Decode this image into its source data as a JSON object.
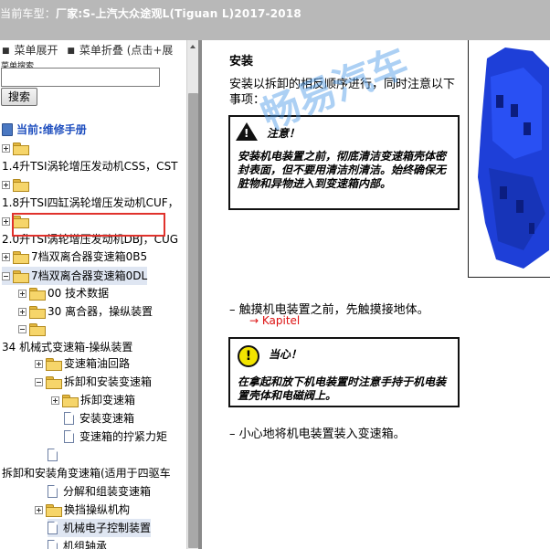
{
  "header": {
    "model_label": "当前车型：",
    "model_value": "厂家:S-上汽大众途观L(Tiguan L)2017-2018"
  },
  "sidebar": {
    "menu_expand": "菜单展开",
    "menu_collapse": "菜单折叠 (点击+展",
    "search_label": "菜单搜索",
    "search_value": "",
    "search_button": "搜索",
    "current_label": "当前:维修手册",
    "tree": {
      "item_1": "1.4升TSI涡轮增压发动机CSS，CST",
      "item_2": "1.8升TSI四缸涡轮增压发动机CUF，",
      "item_3": "2.0升TSI涡轮增压发动机DBJ，CUG",
      "item_4": "7档双离合器变速箱0B5",
      "item_5": "7档双离合器变速箱0DL",
      "item_6": "00 技术数据",
      "item_7": "30 离合器，操纵装置",
      "item_8": "34 机械式变速箱-操纵装置",
      "item_9": "变速箱油回路",
      "item_10": "拆卸和安装变速箱",
      "item_11": "拆卸变速箱",
      "item_12": "安装变速箱",
      "item_13": "变速箱的拧紧力矩",
      "item_14": "拆卸和安装角变速箱(适用于四驱车",
      "item_15": "分解和组装变速箱",
      "item_16": "换挡操纵机构",
      "item_17": "机械电子控制装置",
      "item_18": "机组轴承"
    }
  },
  "content": {
    "title": "安装",
    "intro": "安装以拆卸的相反顺序进行，同时注意以下事项：",
    "note_head": "注意！",
    "note_text": "安装机电装置之前，彻底清洁变速箱壳体密封表面，但不要用清洁剂清洁。始终确保无脏物和异物进入到变速箱内部。",
    "step1": "–   触摸机电装置之前，先触摸接地体。",
    "link": "→ Kapitel",
    "caution_head": "当心！",
    "caution_text": "在拿起和放下机电装置时注意手持于机电装置壳体和电磁阀上。",
    "step2": "–   小心地将机电装置装入变速箱。",
    "watermark": "畅易汽车"
  }
}
